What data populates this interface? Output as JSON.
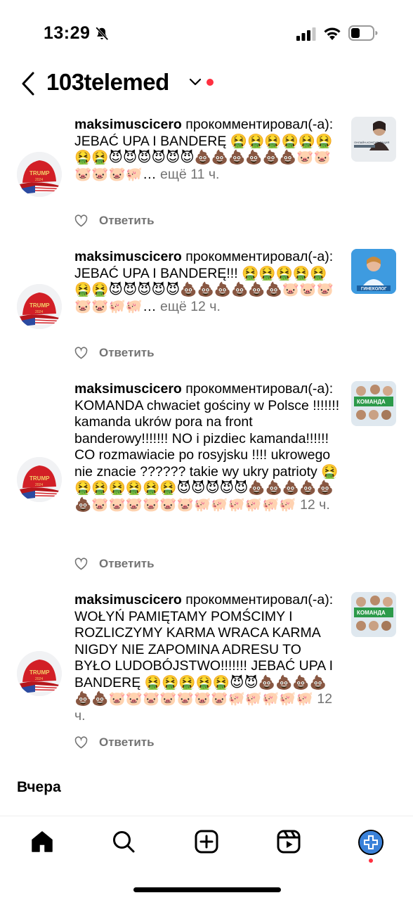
{
  "status_bar": {
    "time": "13:29"
  },
  "header": {
    "account_name": "103telemed"
  },
  "notifications": [
    {
      "username": "maksimuscicero",
      "action": "прокомментировал(-а):",
      "text": "JEBAĆ UPA I BANDERĘ 🤮🤮🤮🤮🤮🤮🤮🤮😈😈😈😈😈😈💩💩💩💩💩💩🐷🐷🐷🐷🐷🐖…",
      "more": "ещё",
      "time": "11 ч.",
      "reply_label": "Ответить",
      "thumb_caption": "ОНЛАЙН-КОНСУЛЬТАЦИЯ"
    },
    {
      "username": "maksimuscicero",
      "action": "прокомментировал(-а):",
      "text": "JEBAĆ UPA I BANDERĘ!!! 🤮🤮🤮🤮🤮🤮🤮😈😈😈😈😈💩💩💩💩💩💩🐷🐷🐷🐷🐷🐖🐖…",
      "more": "ещё",
      "time": "12 ч.",
      "reply_label": "Ответить",
      "thumb_caption": "ГИНЕКОЛОГ"
    },
    {
      "username": "maksimuscicero",
      "action": "прокомментировал(-а):",
      "text": "KOMANDA  chwaciet gościny w Polsce !!!!!!! kamanda ukrów  pora na front banderowy!!!!!!! NO i pizdiec kamanda!!!!!! CO rozmawiacie po rosyjsku !!!! ukrowego nie znacie ?????? takie wy ukry patrioty 🤮🤮🤮🤮🤮🤮🤮😈😈😈😈😈💩💩💩💩💩💩🐷🐷🐷🐷🐷🐷🐖🐖🐖🐖🐖🐖",
      "more": "",
      "time": "12 ч.",
      "reply_label": "Ответить",
      "thumb_caption": "КОМАНДА"
    },
    {
      "username": "maksimuscicero",
      "action": "прокомментировал(-а):",
      "text": "WOŁYŃ PAMIĘTAMY POMŚCIMY I ROZLICZYMY  KARMA WRACA KARMA NIGDY NIE ZAPOMINA ADRESU  TO BYŁO LUDOBÓJSTWO!!!!!!! JEBAĆ UPA I BANDERĘ 🤮🤮🤮🤮🤮😈😈💩💩💩💩💩💩🐷🐷🐷🐷🐷🐷🐷🐖🐖🐖🐖🐖",
      "more": "",
      "time": "12 ч.",
      "reply_label": "Ответить",
      "thumb_caption": "КОМАНДА"
    }
  ],
  "sections": {
    "yesterday": "Вчера"
  },
  "colors": {
    "text": "#000000",
    "secondary": "#737373",
    "notification_dot": "#ff3040",
    "hat_red": "#d21f26",
    "profile_blue": "#3b82d9"
  },
  "icons": {
    "back": "chevron-left-icon",
    "dropdown": "chevron-down-icon",
    "like": "heart-icon",
    "home": "home-icon",
    "search": "search-icon",
    "create": "plus-square-icon",
    "reels": "reels-icon",
    "profile": "profile-avatar"
  }
}
